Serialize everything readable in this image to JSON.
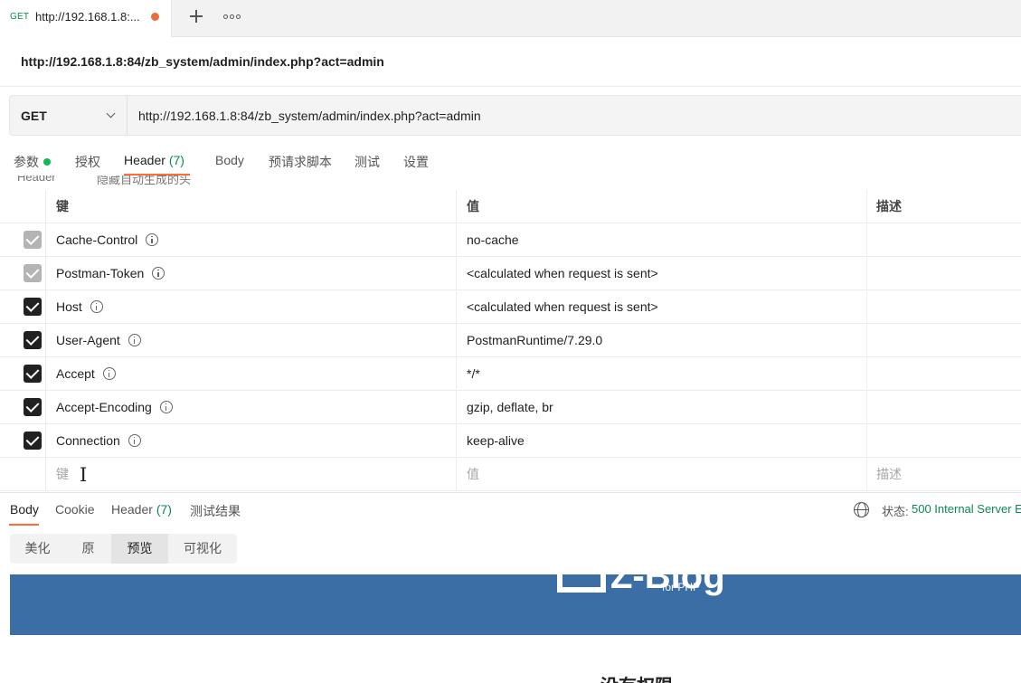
{
  "tab": {
    "method": "GET",
    "title": "http://192.168.1.8:...",
    "unsaved": true
  },
  "request": {
    "name": "http://192.168.1.8:84/zb_system/admin/index.php?act=admin",
    "method": "GET",
    "url": "http://192.168.1.8:84/zb_system/admin/index.php?act=admin"
  },
  "request_tabs": {
    "params": "参数",
    "auth": "授权",
    "headers": "Header",
    "headers_count": "(7)",
    "body": "Body",
    "prerequest": "预请求脚本",
    "tests": "测试",
    "settings": "设置"
  },
  "peek": {
    "left": "Header",
    "right": "隐藏自动生成的头"
  },
  "headers_table": {
    "col_key": "键",
    "col_value": "值",
    "col_desc": "描述",
    "rows": [
      {
        "key": "Cache-Control",
        "value": "no-cache",
        "auto": true
      },
      {
        "key": "Postman-Token",
        "value": "<calculated when request is sent>",
        "auto": true
      },
      {
        "key": "Host",
        "value": "<calculated when request is sent>",
        "auto": false
      },
      {
        "key": "User-Agent",
        "value": "PostmanRuntime/7.29.0",
        "auto": false
      },
      {
        "key": "Accept",
        "value": "*/*",
        "auto": false
      },
      {
        "key": "Accept-Encoding",
        "value": "gzip, deflate, br",
        "auto": false
      },
      {
        "key": "Connection",
        "value": "keep-alive",
        "auto": false
      }
    ],
    "new_row": {
      "key_placeholder": "键",
      "value_placeholder": "值",
      "desc_placeholder": "描述"
    }
  },
  "response_tabs": {
    "body": "Body",
    "cookie": "Cookie",
    "headers": "Header",
    "headers_count": "(7)",
    "test_results": "测试结果"
  },
  "status": {
    "label": "状态:",
    "value": "500 Internal Server E"
  },
  "view_modes": {
    "pretty": "美化",
    "raw": "原",
    "preview": "预览",
    "visualize": "可视化",
    "selected": "预览"
  },
  "preview": {
    "logo_text": "Z-Blog",
    "logo_sub": "for PHP",
    "heading": "没有权限"
  },
  "colors": {
    "accent": "#ff6c37",
    "method_green": "#0b8a4d",
    "status_green": "#0b8a4d",
    "banner_blue": "#3a6ea5"
  },
  "icons": [
    "close-dot-icon",
    "plus-icon",
    "more-icon",
    "chevron-down-icon",
    "checkbox-icon",
    "info-icon",
    "globe-icon",
    "text-cursor-icon"
  ]
}
